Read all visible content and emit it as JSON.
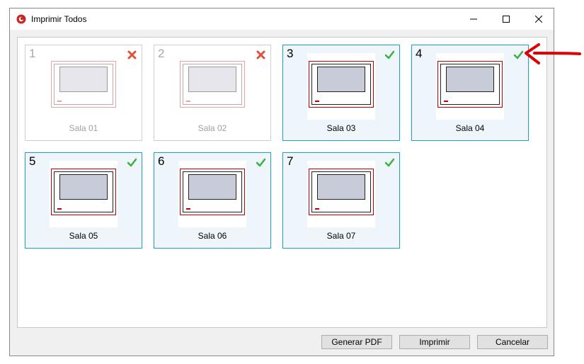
{
  "window": {
    "title": "Imprimir Todos",
    "controls": {
      "minimize_icon": "minimize-icon",
      "maximize_icon": "maximize-icon",
      "close_icon": "close-icon"
    }
  },
  "cards": [
    {
      "number": "1",
      "label": "Sala 01",
      "status": "error"
    },
    {
      "number": "2",
      "label": "Sala 02",
      "status": "error"
    },
    {
      "number": "3",
      "label": "Sala 03",
      "status": "ok"
    },
    {
      "number": "4",
      "label": "Sala 04",
      "status": "ok"
    },
    {
      "number": "5",
      "label": "Sala 05",
      "status": "ok"
    },
    {
      "number": "6",
      "label": "Sala 06",
      "status": "ok"
    },
    {
      "number": "7",
      "label": "Sala 07",
      "status": "ok"
    }
  ],
  "buttons": {
    "pdf": "Generar PDF",
    "print": "Imprimir",
    "cancel": "Cancelar"
  },
  "colors": {
    "selected_border": "#1ba1c4",
    "selected_bg": "#eef6fc",
    "ok_icon": "#3cb043",
    "error_icon": "#e0503a",
    "annotation": "#e00000"
  }
}
